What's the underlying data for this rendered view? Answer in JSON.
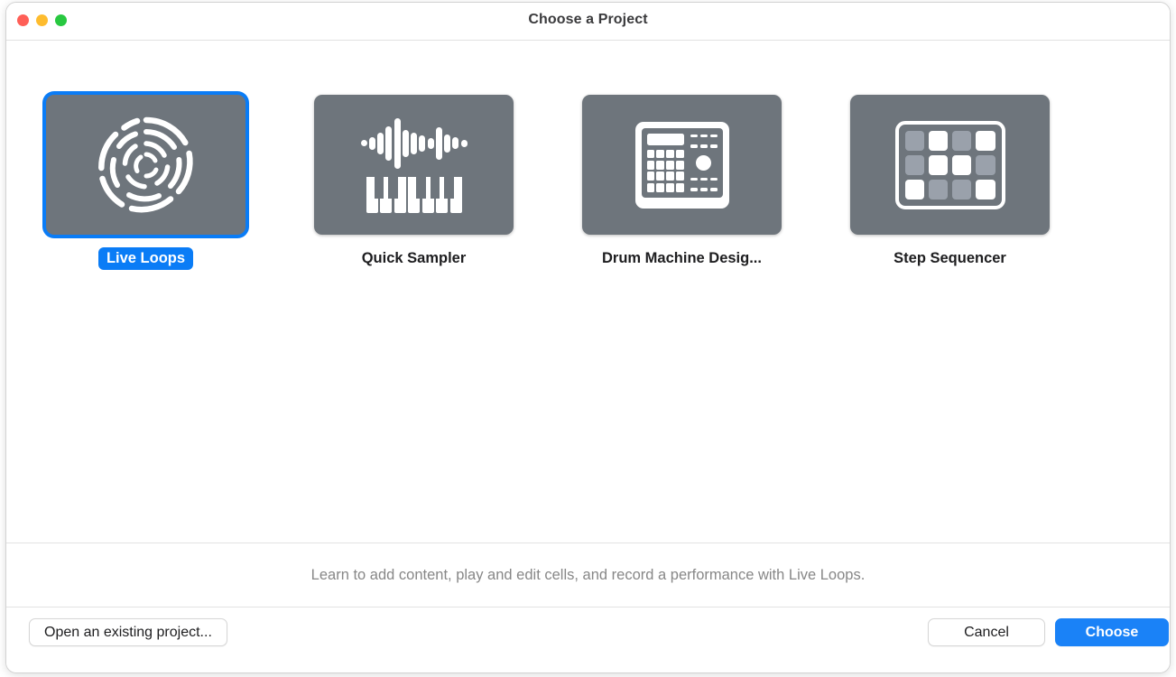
{
  "window": {
    "title": "Choose a Project",
    "traffic_lights": [
      {
        "name": "close",
        "color": "#ff5f57"
      },
      {
        "name": "minimize",
        "color": "#febc2e"
      },
      {
        "name": "zoom",
        "color": "#28c840"
      }
    ]
  },
  "colors": {
    "accent": "#0a7cf6",
    "tile_background": "#6e757c",
    "tile_icon": "#ffffff",
    "step_off": "#9aa1ab",
    "primary_button": "#1a82f7",
    "description_text": "#878787"
  },
  "projects": [
    {
      "id": "live-loops",
      "label": "Live Loops",
      "icon": "live-loops-icon",
      "selected": true
    },
    {
      "id": "quick-sampler",
      "label": "Quick Sampler",
      "icon": "quick-sampler-icon",
      "selected": false
    },
    {
      "id": "drum-machine-designer",
      "label": "Drum Machine Desig...",
      "icon": "drum-machine-icon",
      "selected": false
    },
    {
      "id": "step-sequencer",
      "label": "Step Sequencer",
      "icon": "step-sequencer-icon",
      "selected": false
    }
  ],
  "description": "Learn to add content, play and edit cells, and record a performance with Live Loops.",
  "buttons": {
    "open_existing": "Open an existing project...",
    "cancel": "Cancel",
    "choose": "Choose"
  },
  "icon_details": {
    "quick_sampler": {
      "waveform_heights": [
        7,
        14,
        24,
        38,
        52,
        30,
        24,
        18,
        12,
        34,
        20,
        13,
        8
      ],
      "piano_white_keys": 7
    },
    "step_sequencer": {
      "grid_rows": 3,
      "grid_cols": 4,
      "pattern": [
        [
          0,
          1,
          0,
          1
        ],
        [
          0,
          1,
          1,
          0
        ],
        [
          1,
          0,
          0,
          1
        ]
      ]
    },
    "drum_machine": {
      "pad_rows": 4,
      "pad_cols": 4,
      "has_display": true,
      "has_knob": true
    }
  }
}
